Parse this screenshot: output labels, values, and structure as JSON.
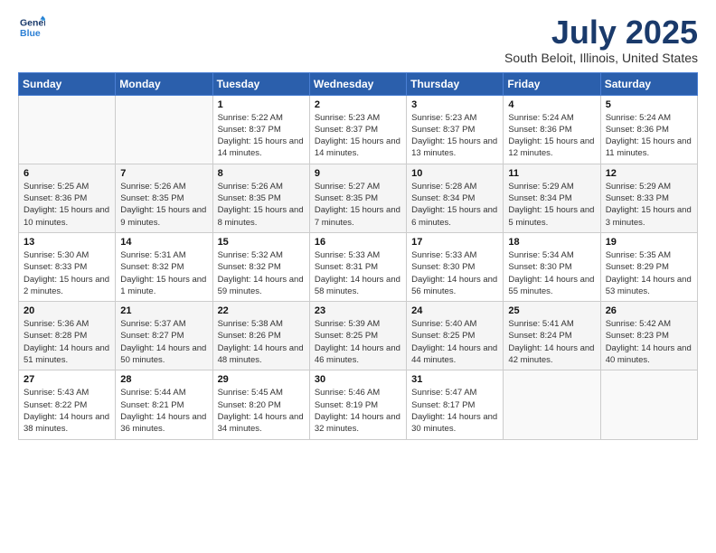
{
  "header": {
    "logo_line1": "General",
    "logo_line2": "Blue",
    "month_year": "July 2025",
    "location": "South Beloit, Illinois, United States"
  },
  "weekdays": [
    "Sunday",
    "Monday",
    "Tuesday",
    "Wednesday",
    "Thursday",
    "Friday",
    "Saturday"
  ],
  "weeks": [
    [
      {
        "day": "",
        "info": ""
      },
      {
        "day": "",
        "info": ""
      },
      {
        "day": "1",
        "info": "Sunrise: 5:22 AM\nSunset: 8:37 PM\nDaylight: 15 hours and 14 minutes."
      },
      {
        "day": "2",
        "info": "Sunrise: 5:23 AM\nSunset: 8:37 PM\nDaylight: 15 hours and 14 minutes."
      },
      {
        "day": "3",
        "info": "Sunrise: 5:23 AM\nSunset: 8:37 PM\nDaylight: 15 hours and 13 minutes."
      },
      {
        "day": "4",
        "info": "Sunrise: 5:24 AM\nSunset: 8:36 PM\nDaylight: 15 hours and 12 minutes."
      },
      {
        "day": "5",
        "info": "Sunrise: 5:24 AM\nSunset: 8:36 PM\nDaylight: 15 hours and 11 minutes."
      }
    ],
    [
      {
        "day": "6",
        "info": "Sunrise: 5:25 AM\nSunset: 8:36 PM\nDaylight: 15 hours and 10 minutes."
      },
      {
        "day": "7",
        "info": "Sunrise: 5:26 AM\nSunset: 8:35 PM\nDaylight: 15 hours and 9 minutes."
      },
      {
        "day": "8",
        "info": "Sunrise: 5:26 AM\nSunset: 8:35 PM\nDaylight: 15 hours and 8 minutes."
      },
      {
        "day": "9",
        "info": "Sunrise: 5:27 AM\nSunset: 8:35 PM\nDaylight: 15 hours and 7 minutes."
      },
      {
        "day": "10",
        "info": "Sunrise: 5:28 AM\nSunset: 8:34 PM\nDaylight: 15 hours and 6 minutes."
      },
      {
        "day": "11",
        "info": "Sunrise: 5:29 AM\nSunset: 8:34 PM\nDaylight: 15 hours and 5 minutes."
      },
      {
        "day": "12",
        "info": "Sunrise: 5:29 AM\nSunset: 8:33 PM\nDaylight: 15 hours and 3 minutes."
      }
    ],
    [
      {
        "day": "13",
        "info": "Sunrise: 5:30 AM\nSunset: 8:33 PM\nDaylight: 15 hours and 2 minutes."
      },
      {
        "day": "14",
        "info": "Sunrise: 5:31 AM\nSunset: 8:32 PM\nDaylight: 15 hours and 1 minute."
      },
      {
        "day": "15",
        "info": "Sunrise: 5:32 AM\nSunset: 8:32 PM\nDaylight: 14 hours and 59 minutes."
      },
      {
        "day": "16",
        "info": "Sunrise: 5:33 AM\nSunset: 8:31 PM\nDaylight: 14 hours and 58 minutes."
      },
      {
        "day": "17",
        "info": "Sunrise: 5:33 AM\nSunset: 8:30 PM\nDaylight: 14 hours and 56 minutes."
      },
      {
        "day": "18",
        "info": "Sunrise: 5:34 AM\nSunset: 8:30 PM\nDaylight: 14 hours and 55 minutes."
      },
      {
        "day": "19",
        "info": "Sunrise: 5:35 AM\nSunset: 8:29 PM\nDaylight: 14 hours and 53 minutes."
      }
    ],
    [
      {
        "day": "20",
        "info": "Sunrise: 5:36 AM\nSunset: 8:28 PM\nDaylight: 14 hours and 51 minutes."
      },
      {
        "day": "21",
        "info": "Sunrise: 5:37 AM\nSunset: 8:27 PM\nDaylight: 14 hours and 50 minutes."
      },
      {
        "day": "22",
        "info": "Sunrise: 5:38 AM\nSunset: 8:26 PM\nDaylight: 14 hours and 48 minutes."
      },
      {
        "day": "23",
        "info": "Sunrise: 5:39 AM\nSunset: 8:25 PM\nDaylight: 14 hours and 46 minutes."
      },
      {
        "day": "24",
        "info": "Sunrise: 5:40 AM\nSunset: 8:25 PM\nDaylight: 14 hours and 44 minutes."
      },
      {
        "day": "25",
        "info": "Sunrise: 5:41 AM\nSunset: 8:24 PM\nDaylight: 14 hours and 42 minutes."
      },
      {
        "day": "26",
        "info": "Sunrise: 5:42 AM\nSunset: 8:23 PM\nDaylight: 14 hours and 40 minutes."
      }
    ],
    [
      {
        "day": "27",
        "info": "Sunrise: 5:43 AM\nSunset: 8:22 PM\nDaylight: 14 hours and 38 minutes."
      },
      {
        "day": "28",
        "info": "Sunrise: 5:44 AM\nSunset: 8:21 PM\nDaylight: 14 hours and 36 minutes."
      },
      {
        "day": "29",
        "info": "Sunrise: 5:45 AM\nSunset: 8:20 PM\nDaylight: 14 hours and 34 minutes."
      },
      {
        "day": "30",
        "info": "Sunrise: 5:46 AM\nSunset: 8:19 PM\nDaylight: 14 hours and 32 minutes."
      },
      {
        "day": "31",
        "info": "Sunrise: 5:47 AM\nSunset: 8:17 PM\nDaylight: 14 hours and 30 minutes."
      },
      {
        "day": "",
        "info": ""
      },
      {
        "day": "",
        "info": ""
      }
    ]
  ],
  "colors": {
    "header_bg": "#2b5fac",
    "title_color": "#1a3a6b"
  }
}
